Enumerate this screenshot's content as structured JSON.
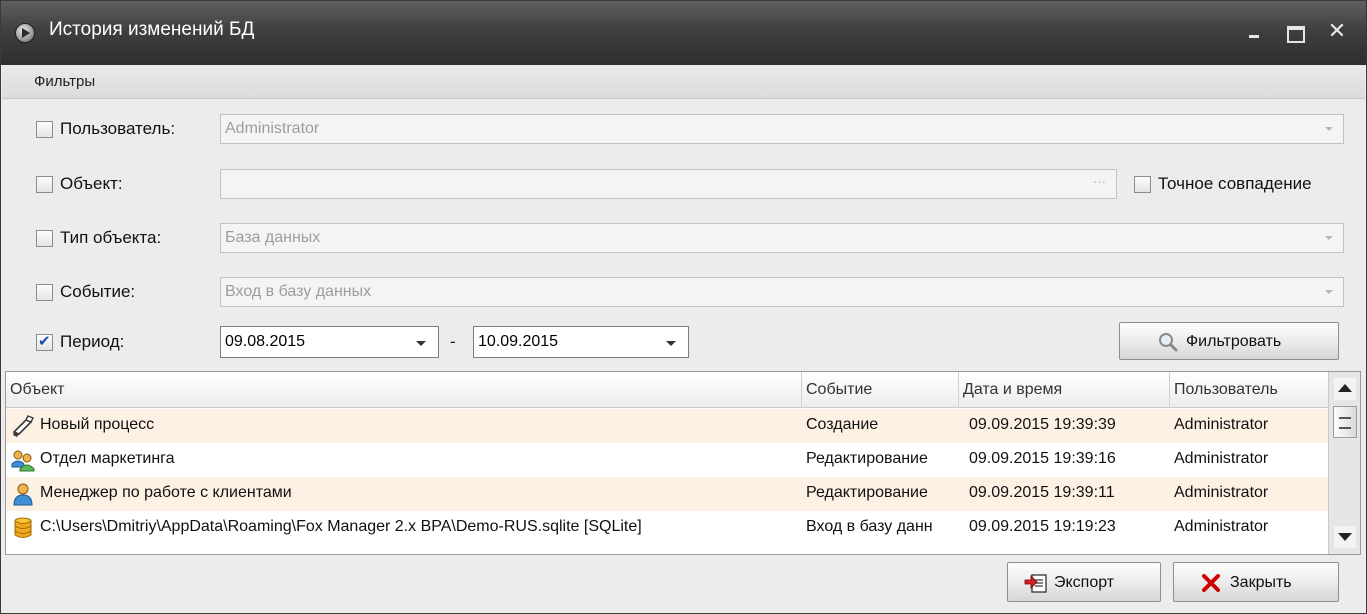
{
  "window": {
    "title": "История изменений БД"
  },
  "filters": {
    "header": "Фильтры",
    "user": {
      "label": "Пользователь:",
      "value": "Administrator",
      "checked": false
    },
    "object": {
      "label": "Объект:",
      "value": "",
      "button": "···",
      "checked": false
    },
    "exact_match": {
      "label": "Точное совпадение",
      "checked": false
    },
    "object_type": {
      "label": "Тип объекта:",
      "value": "База данных",
      "checked": false
    },
    "event": {
      "label": "Событие:",
      "value": "Вход в базу данных",
      "checked": false
    },
    "period": {
      "label": "Период:",
      "from": "09.08.2015",
      "separator": "-",
      "to": "10.09.2015",
      "checked": true
    },
    "filter_button": "Фильтровать"
  },
  "grid": {
    "columns": [
      "Объект",
      "Событие",
      "Дата и время",
      "Пользователь"
    ],
    "rows": [
      {
        "icon": "process-icon",
        "object": "Новый процесс",
        "event": "Создание",
        "datetime": "09.09.2015 19:39:39",
        "user": "Administrator"
      },
      {
        "icon": "department-icon",
        "object": "Отдел маркетинга",
        "event": "Редактирование",
        "datetime": "09.09.2015 19:39:16",
        "user": "Administrator"
      },
      {
        "icon": "employee-icon",
        "object": "Менеджер по работе с клиентами",
        "event": "Редактирование",
        "datetime": "09.09.2015 19:39:11",
        "user": "Administrator"
      },
      {
        "icon": "database-icon",
        "object": "C:\\Users\\Dmitriy\\AppData\\Roaming\\Fox Manager 2.x BPA\\Demo-RUS.sqlite [SQLite]",
        "event": "Вход в базу данн",
        "datetime": "09.09.2015 19:19:23",
        "user": "Administrator"
      }
    ]
  },
  "footer": {
    "export_label": "Экспорт",
    "close_label": "Закрыть"
  },
  "colors": {
    "titlebar": "#3f3f3f",
    "row_highlight": "#fdf1e4",
    "accent": "#1b4fb4",
    "close_red": "#d00000"
  }
}
